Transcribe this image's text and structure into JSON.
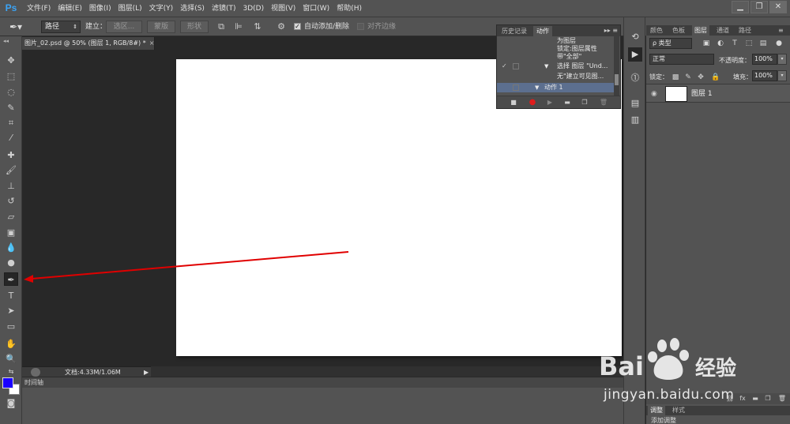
{
  "app": {
    "logo": "Ps",
    "menu": [
      "文件(F)",
      "编辑(E)",
      "图像(I)",
      "图层(L)",
      "文字(Y)",
      "选择(S)",
      "滤镜(T)",
      "3D(D)",
      "视图(V)",
      "窗口(W)",
      "帮助(H)"
    ],
    "window_buttons": [
      "▁",
      "❐",
      "✕"
    ]
  },
  "options_bar": {
    "tool_icon": "pen-tool-icon",
    "mode_select": "路径",
    "make_label": "建立：",
    "btn_selection": "选区...",
    "btn_mask": "蒙版",
    "btn_shape": "形状",
    "auto_add_delete_label": "自动添加/删除",
    "auto_add_delete_checked": true,
    "align_edges_label": "对齐边缘",
    "align_edges_checked": false
  },
  "document": {
    "tab_title": "图片_02.psd @ 50% (图层 1, RGB/8#) *",
    "tab_close": "×",
    "status_doc_info": "文档:4.33M/1.06M",
    "timeline_label": "时间轴"
  },
  "colors": {
    "foreground": "#1a00ff",
    "background": "#ffffff",
    "annotation_arrow": "#e00000",
    "panel": "#535353",
    "pasteboard": "#282828",
    "selected_row": "#5c6f8f"
  },
  "actions_panel": {
    "tabs": [
      "历史记录",
      "动作"
    ],
    "active_tab": "动作",
    "rows": [
      {
        "text": "为图层"
      },
      {
        "text": "锁定:图层属性"
      },
      {
        "text": "带\"全部\""
      },
      {
        "text": "选择 图层 \"Und..."
      },
      {
        "text": "无\"建立可见图..."
      },
      {
        "text": "动作 1"
      }
    ]
  },
  "layers_panel": {
    "tabs": [
      "颜色",
      "色板",
      "图层",
      "通道",
      "路径"
    ],
    "active_tab": "图层",
    "filter_label": "ρ 类型",
    "blend_mode": "正常",
    "opacity_label": "不透明度：",
    "opacity_value": "100%",
    "lock_label": "锁定：",
    "fill_label": "填充：",
    "fill_value": "100%",
    "layers": [
      {
        "name": "图层 1"
      }
    ],
    "lower_tabs": [
      "调整",
      "样式"
    ],
    "lower_sub": "添加调整"
  },
  "watermark": {
    "brand": "Bai du 经验",
    "url": "jingyan.baidu.com"
  }
}
